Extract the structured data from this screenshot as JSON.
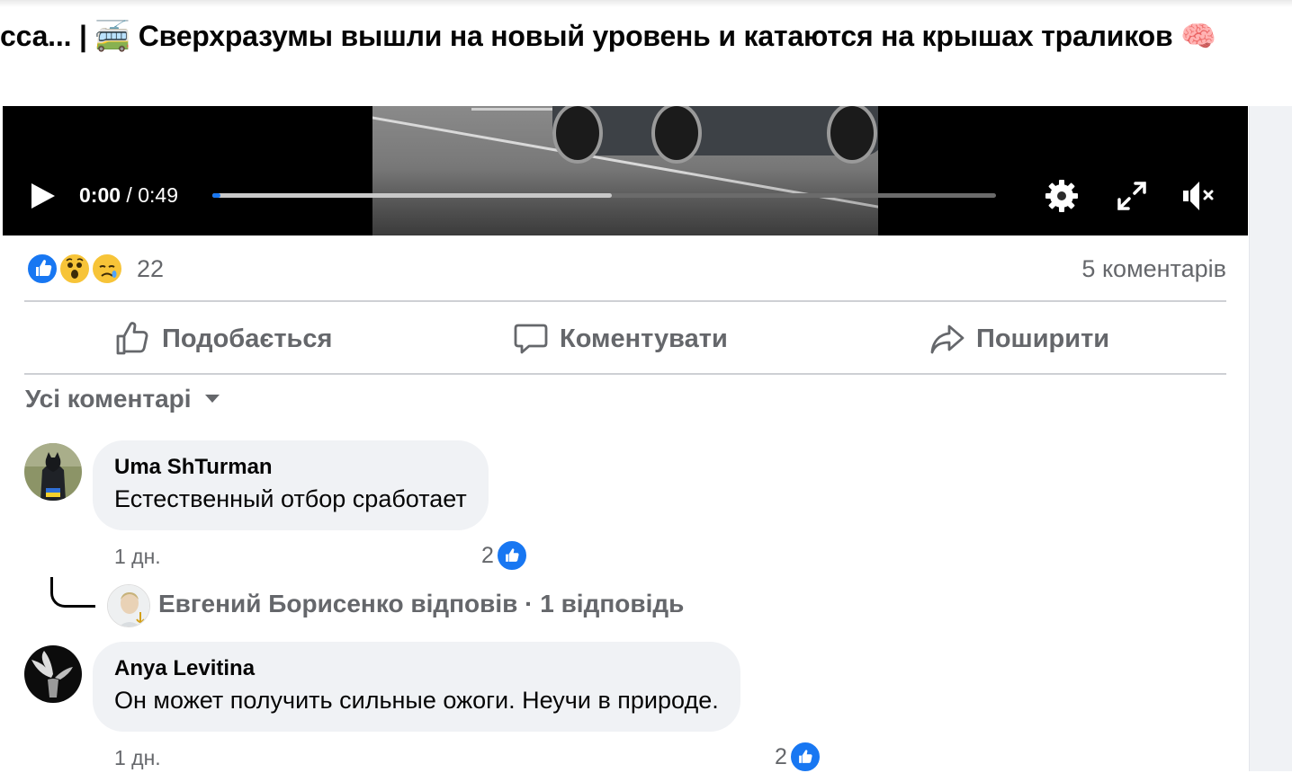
{
  "post": {
    "title_prefix": "сса... | ",
    "title_emoji": "🚎",
    "title_text": " Сверхразумы вышли на новый уровень и катаются на крышах траликов ",
    "title_emoji_end": "🧠"
  },
  "video": {
    "current_time": "0:00",
    "separator": " / ",
    "duration": "0:49",
    "progress_played": 0.01,
    "progress_buffered": 0.51,
    "icons": [
      "play-icon",
      "settings-gear-icon",
      "fullscreen-icon",
      "muted-volume-icon"
    ]
  },
  "reactions": {
    "types": [
      "like",
      "wow",
      "sad"
    ],
    "count": "22",
    "comments_count": "5 коментарів"
  },
  "actions": {
    "like_label": "Подобається",
    "comment_label": "Коментувати",
    "share_label": "Поширити"
  },
  "comments_filter": {
    "label": "Усі коментарі"
  },
  "comments": [
    {
      "author": "Uma ShTurman",
      "text": "Естественный отбор сработает",
      "time": "1 дн.",
      "likes": "2",
      "reply_summary": "Евгений Борисенко відповів · 1 відповідь"
    },
    {
      "author": "Anya Levitina",
      "text": "Он может получить сильные ожоги. Неучи в природе.",
      "time": "1 дн.",
      "likes": "2"
    }
  ],
  "colors": {
    "accent": "#1877f2",
    "secondary_text": "#65676b",
    "bubble": "#f0f2f5",
    "divider": "#ced0d4"
  }
}
